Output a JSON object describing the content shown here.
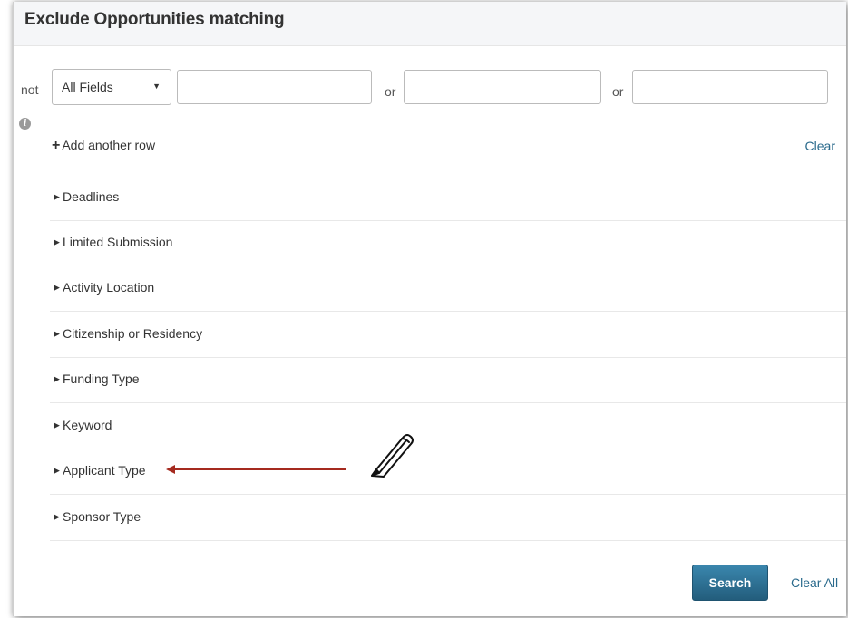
{
  "header": {
    "title": "Exclude Opportunities matching"
  },
  "filter_row": {
    "prefix": "not",
    "field_select": {
      "value": "All Fields"
    },
    "inputs": [
      {
        "value": "",
        "placeholder": ""
      },
      {
        "value": "",
        "placeholder": ""
      },
      {
        "value": "",
        "placeholder": ""
      }
    ],
    "separators": [
      "or",
      "or"
    ]
  },
  "actions": {
    "add_row_icon": "plus-icon",
    "add_row": "Add another row",
    "clear": "Clear",
    "search": "Search",
    "clear_all": "Clear All"
  },
  "sections": [
    {
      "label": "Deadlines"
    },
    {
      "label": "Limited Submission"
    },
    {
      "label": "Activity Location"
    },
    {
      "label": "Citizenship or Residency"
    },
    {
      "label": "Funding Type"
    },
    {
      "label": "Keyword"
    },
    {
      "label": "Applicant Type"
    },
    {
      "label": "Sponsor Type"
    }
  ],
  "annotation": {
    "arrow_color": "#a52a1f",
    "icon": "pencil-icon"
  },
  "colors": {
    "accent": "#2b6f93",
    "link": "#2a6a8c"
  }
}
